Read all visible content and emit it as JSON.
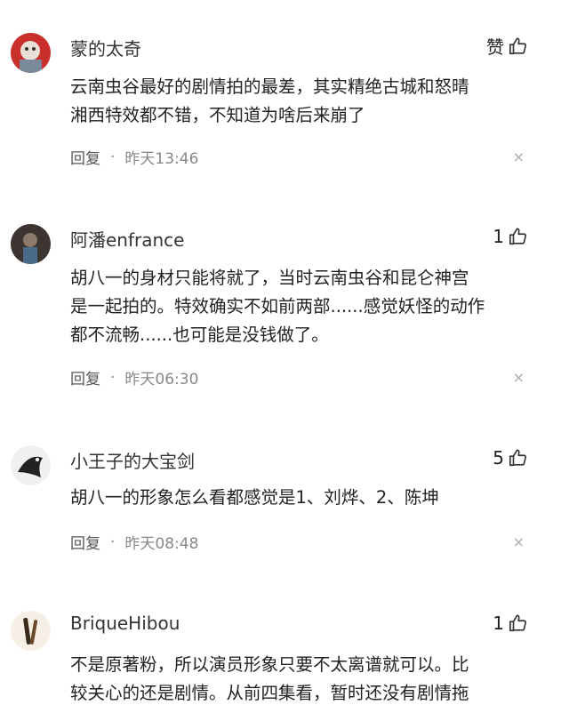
{
  "comments": [
    {
      "username": "蒙的太奇",
      "likes": "赞",
      "lines": [
        "云南虫谷最好的剧情拍的最差，其实精绝古城和怒晴",
        "湘西特效都不错，不知道为啥后来崩了"
      ],
      "reply": "回复",
      "time": "昨天13:46",
      "close": "×"
    },
    {
      "username": "阿潘enfrance",
      "likes": "1",
      "lines": [
        "胡八一的身材只能将就了，当时云南虫谷和昆仑神宫",
        "是一起拍的。特效确实不如前两部......感觉妖怪的动作",
        "都不流畅......也可能是没钱做了。"
      ],
      "reply": "回复",
      "time": "昨天06:30",
      "close": "×"
    },
    {
      "username": "小王子的大宝剑",
      "likes": "5",
      "lines": [
        "胡八一的形象怎么看都感觉是1、刘烨、2、陈坤"
      ],
      "reply": "回复",
      "time": "昨天08:48",
      "close": "×"
    },
    {
      "username": "BriqueHibou",
      "likes": "1",
      "lines": [
        "不是原著粉，所以演员形象只要不太离谱就可以。比",
        "较关心的还是剧情。从前四集看，暂时还没有剧情拖"
      ]
    }
  ],
  "icons": {
    "like": "thumbs-up-icon",
    "close": "close-icon"
  }
}
